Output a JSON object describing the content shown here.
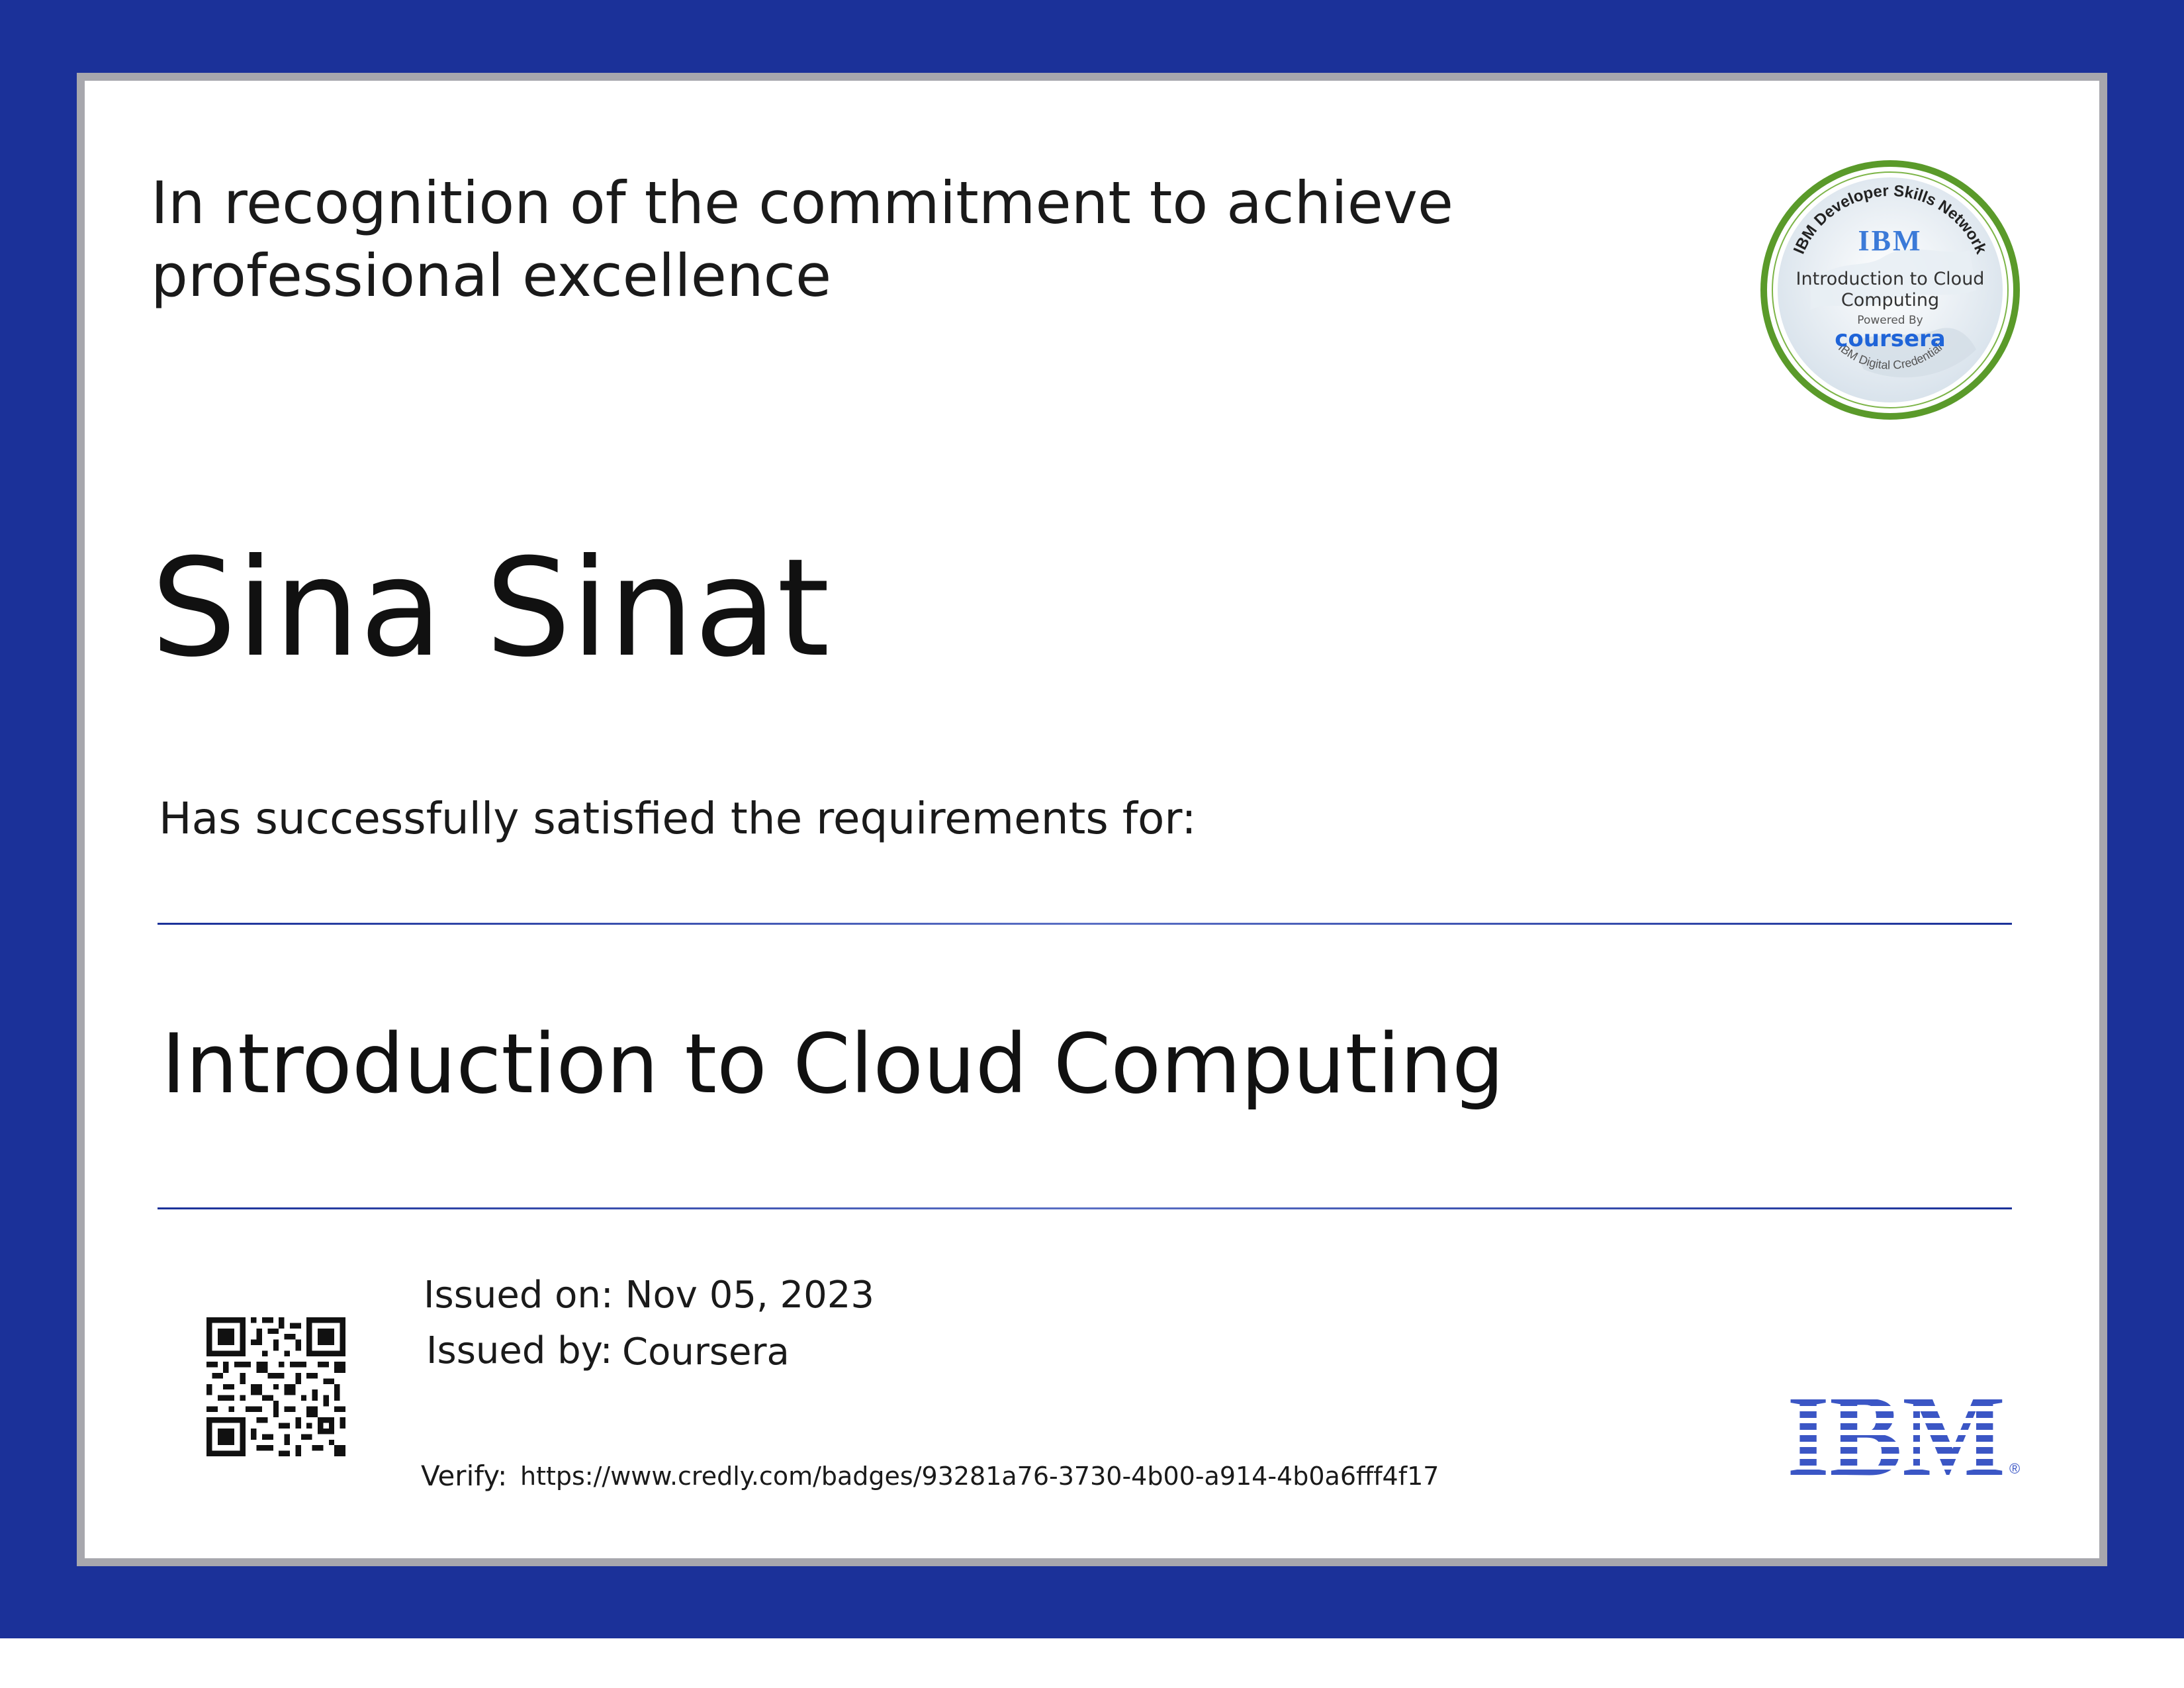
{
  "certificate": {
    "recognition_line1": "In recognition of the commitment to achieve",
    "recognition_line2": "professional excellence",
    "recipient": "Sina Sinat",
    "requirement_text": "Has successfully satisfied the requirements for:",
    "course": "Introduction to Cloud Computing",
    "issued_on_label": "Issued on:",
    "issued_on_value": "Nov 05, 2023",
    "issued_by_label": "Issued by:",
    "issued_by_value": "Coursera",
    "verify_label": "Verify:",
    "verify_url": "https://www.credly.com/badges/93281a76-3730-4b00-a914-4b0a6fff4f17"
  },
  "badge": {
    "arc_top": "IBM Developer Skills Network",
    "logo": "IBM",
    "title_line1": "Introduction to Cloud",
    "title_line2": "Computing",
    "powered_by": "Powered By",
    "brand": "coursera",
    "arc_bottom": "IBM Digital Credential"
  },
  "logo": {
    "text": "IBM",
    "registered_mark": "®"
  },
  "colors": {
    "frame": "#1b3199",
    "card_border": "#a7a7ad",
    "rule": "#5a6fc4",
    "ibm_blue": "#3b56c5",
    "badge_green": "#5a9a2a",
    "coursera_blue": "#1f64d8"
  },
  "icons": {
    "qr": "qr-code-icon"
  }
}
